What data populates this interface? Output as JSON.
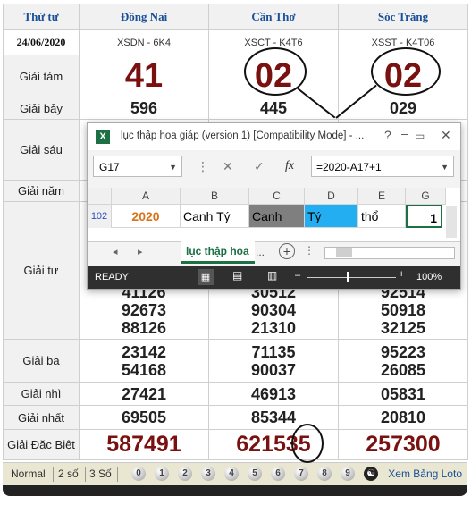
{
  "header": {
    "col0": "Thứ tư",
    "col1": "Đồng Nai",
    "col2": "Cần Thơ",
    "col3": "Sóc Trăng"
  },
  "subheader": {
    "date": "24/06/2020",
    "code1": "XSDN - 6K4",
    "code2": "XSCT - K4T6",
    "code3": "XSST - K4T06"
  },
  "prizes": {
    "g8": {
      "label": "Giải tám",
      "values": [
        "41",
        "02",
        "02"
      ]
    },
    "g7": {
      "label": "Giải bảy",
      "values": [
        "596",
        "445",
        "029"
      ]
    },
    "g6": {
      "label": "Giải sáu"
    },
    "g5": {
      "label": "Giải năm"
    },
    "g4": {
      "label": "Giải tư",
      "values": [
        [
          "41126",
          "92673",
          "88126"
        ],
        [
          "30512",
          "90304",
          "21310"
        ],
        [
          "92514",
          "50918",
          "32125"
        ]
      ]
    },
    "g3": {
      "label": "Giải ba",
      "values": [
        [
          "23142",
          "54168"
        ],
        [
          "71135",
          "90037"
        ],
        [
          "95223",
          "26085"
        ]
      ]
    },
    "g2": {
      "label": "Giải nhì",
      "values": [
        "27421",
        "46913",
        "05831"
      ]
    },
    "g1": {
      "label": "Giải nhất",
      "values": [
        "69505",
        "85344",
        "20810"
      ]
    },
    "db": {
      "label": "Giải Đặc Biệt",
      "values": [
        "587491",
        "621535",
        "257300"
      ]
    }
  },
  "bottom_bar": {
    "normal": "Normal",
    "two": "2 số",
    "three": "3 Số",
    "balls": [
      "0",
      "1",
      "2",
      "3",
      "4",
      "5",
      "6",
      "7",
      "8",
      "9"
    ],
    "loto": "Xem Bảng Loto"
  },
  "excel": {
    "title": "lục thập hoa giáp (version 1)  [Compatibility Mode] - ...",
    "namebox": "G17",
    "formula": "=2020-A17+1",
    "fx": "fx",
    "columns": [
      "A",
      "B",
      "C",
      "D",
      "E",
      "G"
    ],
    "row_number": "102",
    "cells": [
      "2020",
      "Canh Tý",
      "Canh",
      "Tý",
      "thổ",
      "1"
    ],
    "sheet_tab": "lục thập hoa",
    "tab_more": "...",
    "status": "READY",
    "zoom": "100%",
    "colors": {
      "green": "#1d7044",
      "orange": "#d9731a",
      "gray_cell": "#7f7f7f",
      "blue_cell": "#22aef0"
    }
  }
}
